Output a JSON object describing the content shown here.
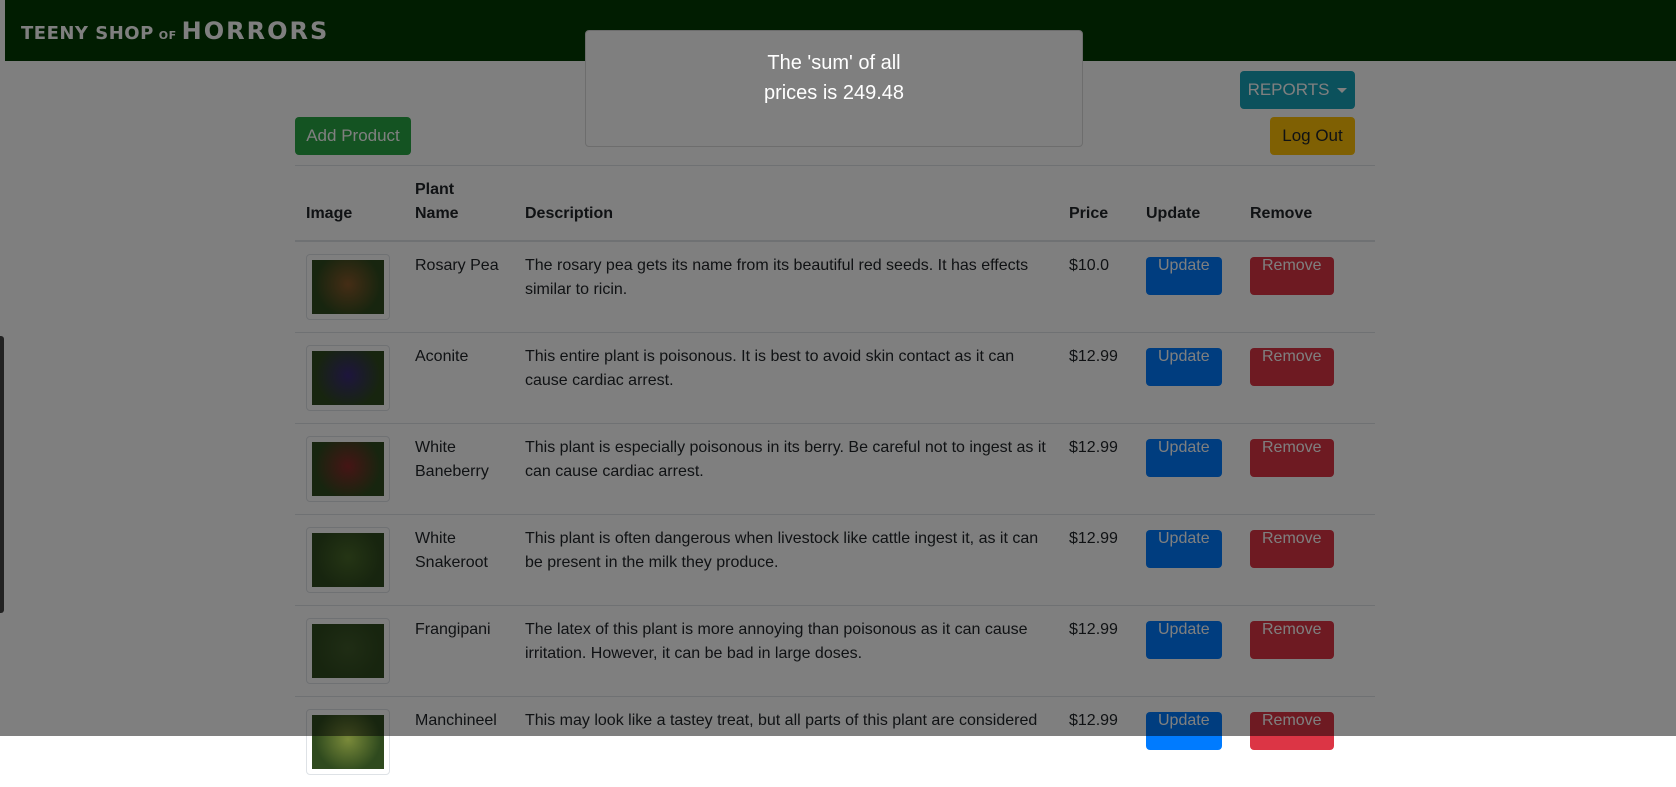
{
  "brand": {
    "part1": "TEENY SHOP",
    "part2": "OF",
    "part3": "HORRORS"
  },
  "actions": {
    "add_product": "Add Product",
    "reports": "REPORTS",
    "logout": "Log Out"
  },
  "table": {
    "headers": {
      "image": "Image",
      "plant_name_line1": "Plant",
      "plant_name_line2": "Name",
      "description": "Description",
      "price": "Price",
      "update": "Update",
      "remove": "Remove"
    },
    "rows": [
      {
        "name": "Rosary Pea",
        "description": "The rosary pea gets its name from its beautiful red seeds. It has effects similar to ricin.",
        "price": "$10.0",
        "update": "Update",
        "remove": "Remove",
        "thumb_color": "#8a5a2b"
      },
      {
        "name": "Aconite",
        "description": "This entire plant is poisonous. It is best to avoid skin contact as it can cause cardiac arrest.",
        "price": "$12.99",
        "update": "Update",
        "remove": "Remove",
        "thumb_color": "#3b2a7a"
      },
      {
        "name": "White Baneberry",
        "description": "This plant is especially poisonous in its berry. Be careful not to ingest as it can cause cardiac arrest.",
        "price": "$12.99",
        "update": "Update",
        "remove": "Remove",
        "thumb_color": "#8b2a2a"
      },
      {
        "name": "White Snakeroot",
        "description": "This plant is often dangerous when livestock like cattle ingest it, as it can be present in the milk they produce.",
        "price": "$12.99",
        "update": "Update",
        "remove": "Remove",
        "thumb_color": "#4a6a2a"
      },
      {
        "name": "Frangipani",
        "description": "The latex of this plant is more annoying than poisonous as it can cause irritation. However, it can be bad in large doses.",
        "price": "$12.99",
        "update": "Update",
        "remove": "Remove",
        "thumb_color": "#3f5a2a"
      },
      {
        "name": "Manchineel",
        "description": "This may look like a tastey treat, but all parts of this plant are considered",
        "price": "$12.99",
        "update": "Update",
        "remove": "Remove",
        "thumb_color": "#7a8a3a"
      }
    ]
  },
  "toast": {
    "line1": "The 'sum' of all",
    "line2": "prices is 249.48"
  },
  "colors": {
    "navbar": "#033b03",
    "success": "#28a745",
    "info": "#17a2b8",
    "warning": "#ffc107",
    "primary": "#007bff",
    "danger": "#dc3545"
  }
}
